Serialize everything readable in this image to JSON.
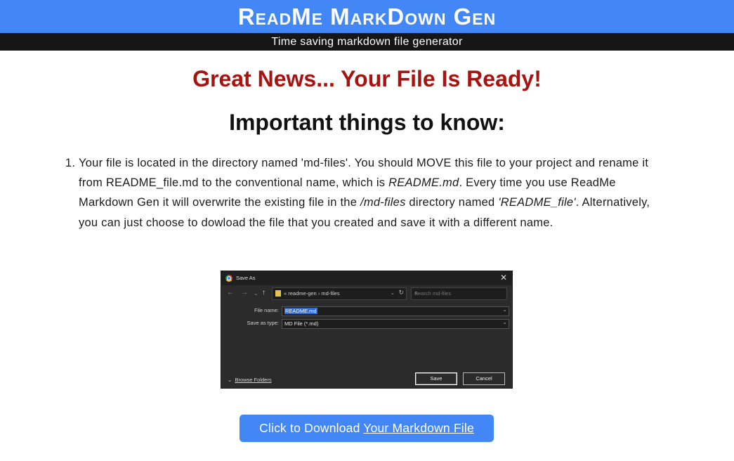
{
  "header": {
    "title": "ReadMe MarkDown Gen",
    "subtitle": "Time saving markdown file generator"
  },
  "main": {
    "headline": "Great News... Your File Is Ready!",
    "section_title": "Important things to know:",
    "steps": [
      {
        "number": "1.",
        "part1": "Your file is located in the directory named 'md-files'. You should MOVE this file to your project and rename it from README_file.md to the conventional name, which is ",
        "em1": "README.md",
        "part2": ". Every time you use ReadMe Markdown Gen it will overwrite the existing file in the ",
        "em2": "/md-files",
        "part3": " directory named ",
        "em3": "'README_file'",
        "part4": ". Alternatively, you can just choose to dowload the file that you created and save it with a different name."
      }
    ]
  },
  "dialog": {
    "title": "Save As",
    "close": "✕",
    "path_prefix": "«",
    "path_folder1": "readme-gen",
    "path_sep": "›",
    "path_folder2": "md-files",
    "search_placeholder": "Search md-files",
    "file_name_label": "File name:",
    "file_name_value": "README.md",
    "save_type_label": "Save as type:",
    "save_type_value": "MD File (*.md)",
    "browse_folders": "Browse Folders",
    "save_button": "Save",
    "cancel_button": "Cancel"
  },
  "download": {
    "prefix": "Click to Download ",
    "link": "Your Markdown File"
  },
  "colors": {
    "header_bg": "#4287f5",
    "subbar_bg": "#161616",
    "headline": "#a51410",
    "button_bg": "#4287f5"
  }
}
